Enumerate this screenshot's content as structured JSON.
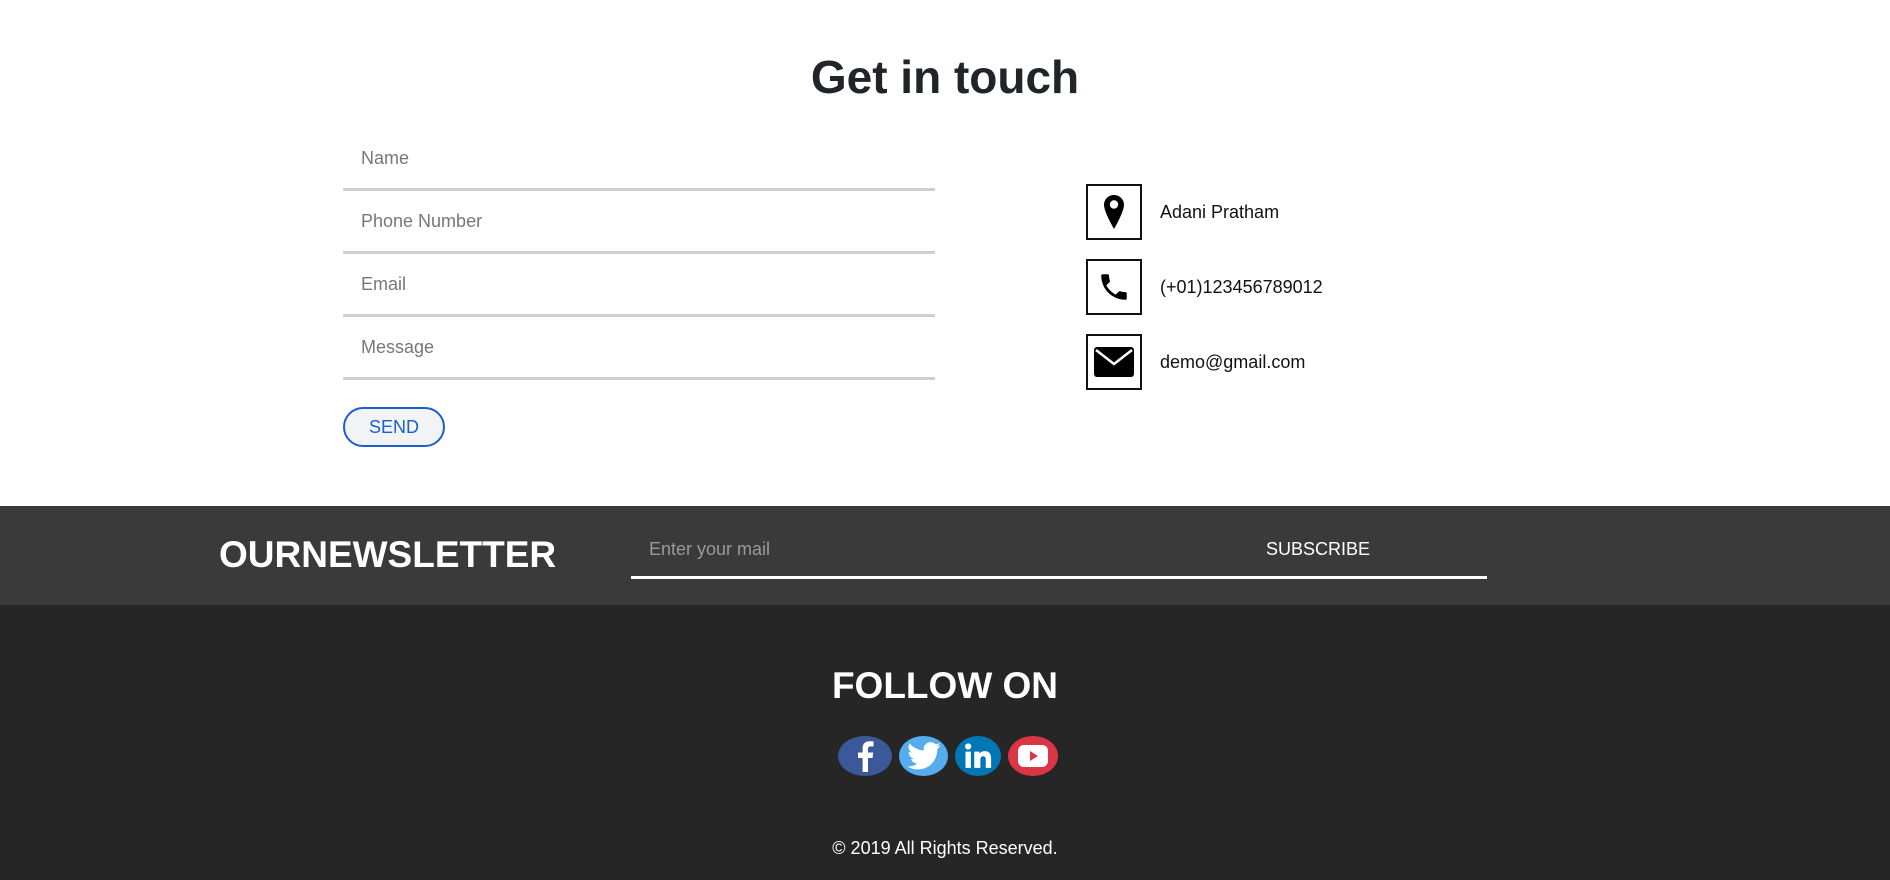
{
  "contact": {
    "title": "Get in touch",
    "form": {
      "name_placeholder": "Name",
      "phone_placeholder": "Phone Number",
      "email_placeholder": "Email",
      "message_placeholder": "Message",
      "send_label": "SEND"
    },
    "info": [
      {
        "icon": "map-pin-icon",
        "text": "Adani Pratham"
      },
      {
        "icon": "phone-icon",
        "text": "(+01)123456789012"
      },
      {
        "icon": "envelope-icon",
        "text": "demo@gmail.com"
      }
    ]
  },
  "newsletter": {
    "title": "OURNEWSLETTER",
    "input_placeholder": "Enter your mail",
    "subscribe_label": "SUBSCRIBE"
  },
  "footer": {
    "follow_title": "FOLLOW ON",
    "social": [
      {
        "icon": "facebook-icon",
        "color": "#3b5998"
      },
      {
        "icon": "twitter-icon",
        "color": "#55acee"
      },
      {
        "icon": "linkedin-icon",
        "color": "#0077b5"
      },
      {
        "icon": "youtube-icon",
        "color": "#dc3545"
      }
    ],
    "copyright": "© 2019 All Rights Reserved."
  },
  "colors": {
    "accent": "#1a5fd0",
    "newsletter_bg": "#3a3a3a",
    "footer_bg": "#262626"
  }
}
